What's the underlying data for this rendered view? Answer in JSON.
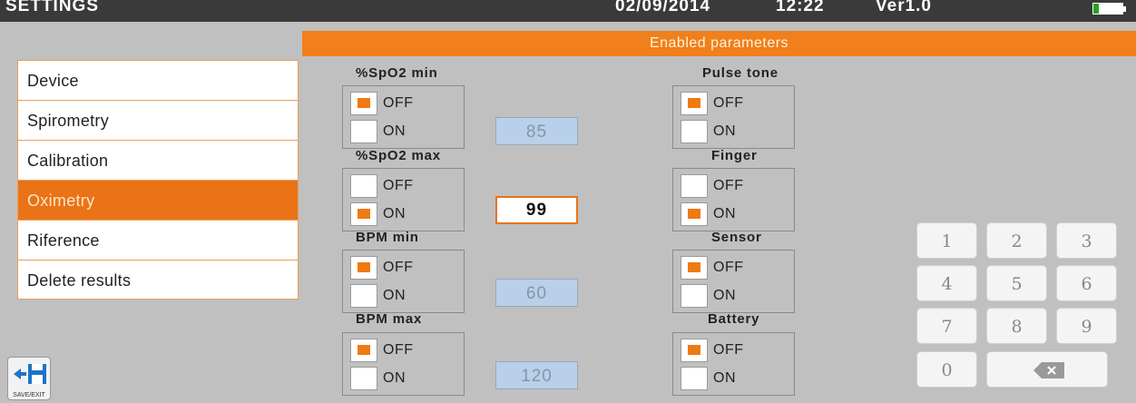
{
  "topbar": {
    "title": "SETTINGS",
    "date": "02/09/2014",
    "time": "12:22",
    "version": "Ver1.0",
    "battery_level": 0.2
  },
  "header": {
    "title": "Enabled parameters"
  },
  "sidebar": {
    "items": [
      {
        "label": "Device",
        "active": false
      },
      {
        "label": "Spirometry",
        "active": false
      },
      {
        "label": "Calibration",
        "active": false
      },
      {
        "label": "Oximetry",
        "active": true
      },
      {
        "label": "Riference",
        "active": false
      },
      {
        "label": "Delete results",
        "active": false
      }
    ],
    "save_exit_label": "SAVE/EXIT"
  },
  "params": {
    "spo2_min": {
      "title": "%SpO2 min",
      "off": "OFF",
      "on": "ON",
      "selected": "OFF",
      "value": "85"
    },
    "spo2_max": {
      "title": "%SpO2 max",
      "off": "OFF",
      "on": "ON",
      "selected": "ON",
      "value": "99"
    },
    "bpm_min": {
      "title": "BPM min",
      "off": "OFF",
      "on": "ON",
      "selected": "OFF",
      "value": "60"
    },
    "bpm_max": {
      "title": "BPM max",
      "off": "OFF",
      "on": "ON",
      "selected": "OFF",
      "value": "120"
    },
    "pulsetone": {
      "title": "Pulse tone",
      "off": "OFF",
      "on": "ON",
      "selected": "OFF"
    },
    "finger": {
      "title": "Finger",
      "off": "OFF",
      "on": "ON",
      "selected": "ON"
    },
    "sensor": {
      "title": "Sensor",
      "off": "OFF",
      "on": "ON",
      "selected": "OFF"
    },
    "battery": {
      "title": "Battery",
      "off": "OFF",
      "on": "ON",
      "selected": "OFF"
    }
  },
  "keypad": {
    "keys": [
      "1",
      "2",
      "3",
      "4",
      "5",
      "6",
      "7",
      "8",
      "9",
      "0"
    ],
    "backspace_icon": "backspace-icon"
  },
  "colors": {
    "accent": "#f07f1c",
    "checkbox_on": "#ef7a12",
    "disabled_field": "#b8d0ea"
  }
}
